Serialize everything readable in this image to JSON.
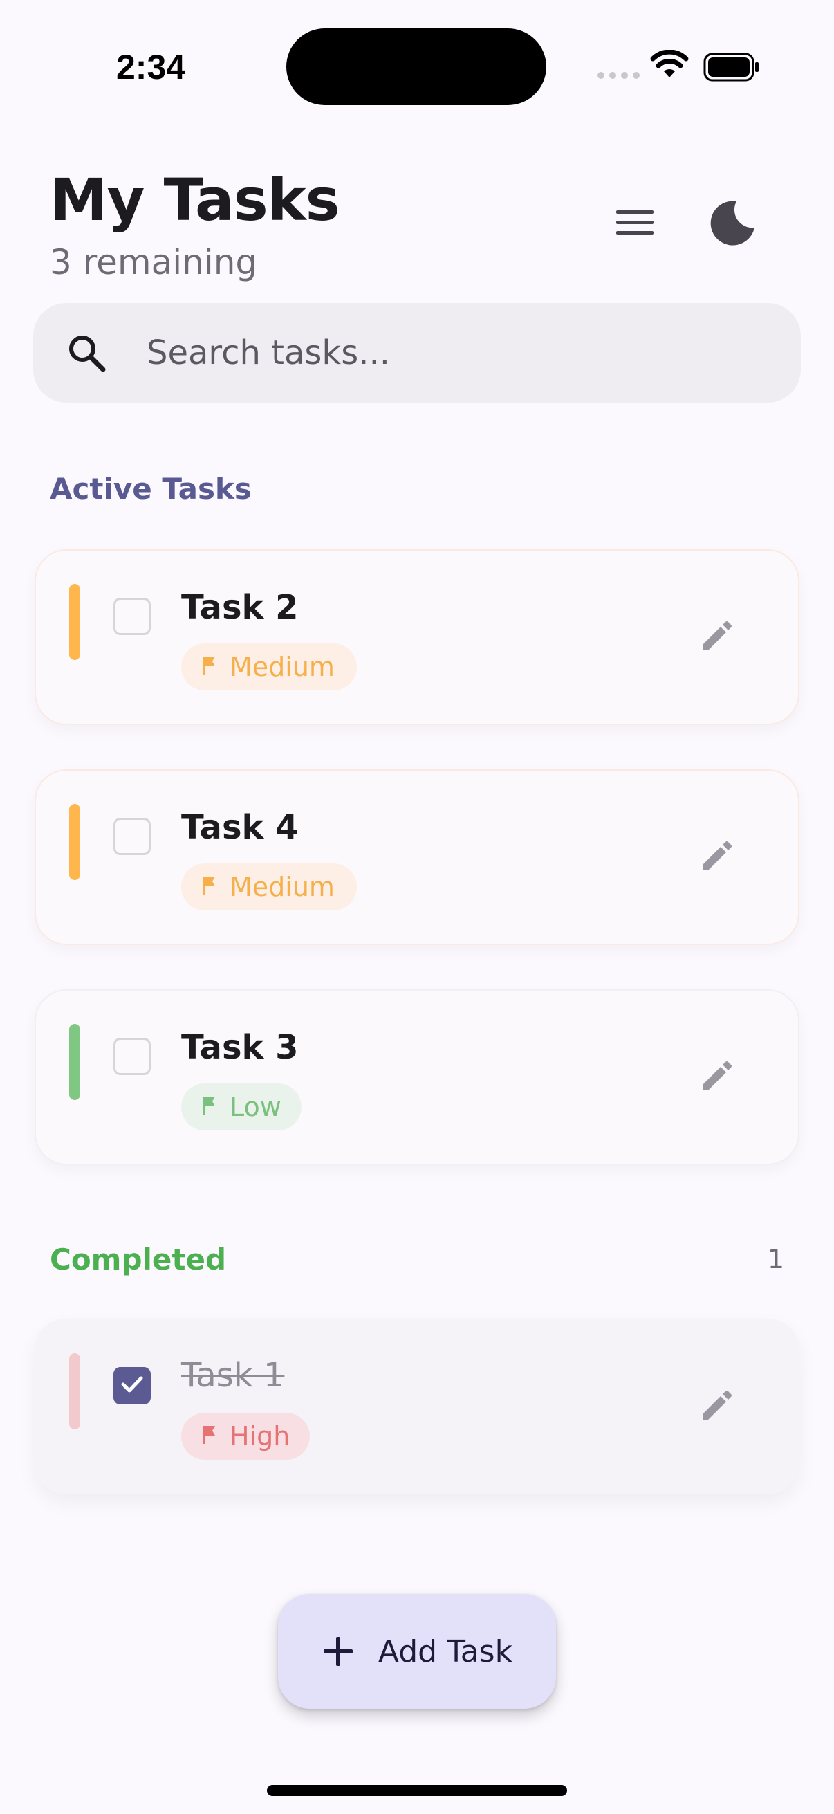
{
  "status_bar": {
    "time": "2:34"
  },
  "header": {
    "title": "My Tasks",
    "subtitle": "3 remaining",
    "menu_icon": "hamburger-menu-icon",
    "theme_icon": "moon-icon"
  },
  "search": {
    "placeholder": "Search tasks..."
  },
  "sections": {
    "active": {
      "title": "Active Tasks"
    },
    "completed": {
      "title": "Completed",
      "count": "1"
    }
  },
  "tasks": [
    {
      "title": "Task 2",
      "priority": "Medium",
      "completed": false,
      "color": "#FFB74D",
      "chip_bg": "#FDEFE6",
      "chip_fg": "#F5B04C"
    },
    {
      "title": "Task 4",
      "priority": "Medium",
      "completed": false,
      "color": "#FFB74D",
      "chip_bg": "#FDEFE6",
      "chip_fg": "#F5B04C"
    },
    {
      "title": "Task 3",
      "priority": "Low",
      "completed": false,
      "color": "#81C784",
      "chip_bg": "#EAF2EC",
      "chip_fg": "#7CC07F"
    }
  ],
  "completed_tasks": [
    {
      "title": "Task 1",
      "priority": "High",
      "completed": true,
      "color": "#F2C9CC",
      "chip_bg": "#F8DFE4",
      "chip_fg": "#E57373"
    }
  ],
  "fab": {
    "label": "Add Task",
    "icon": "plus-icon"
  },
  "colors": {
    "accent": "#5C5A93",
    "background": "#FBF8FE",
    "completed_green": "#4CAF50"
  }
}
